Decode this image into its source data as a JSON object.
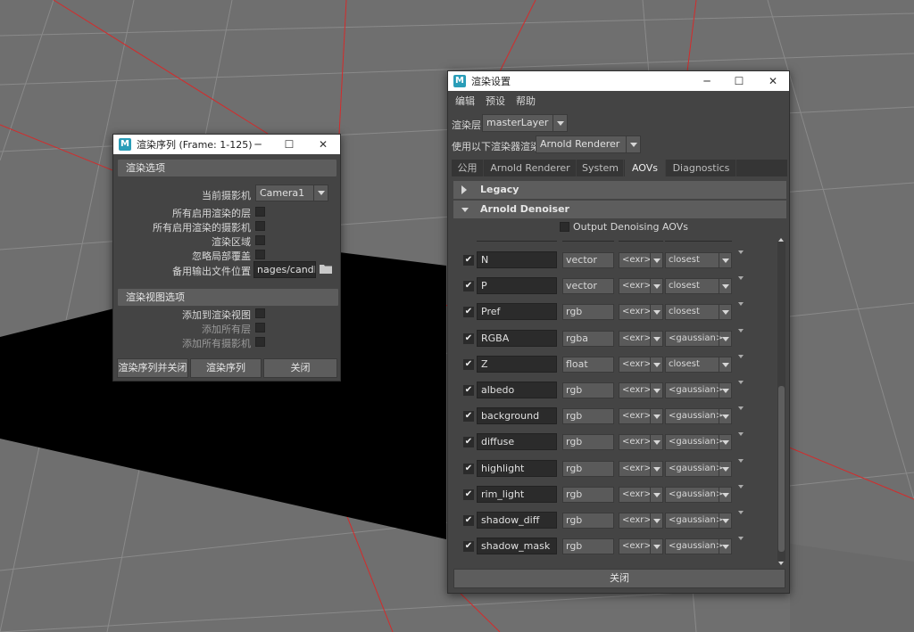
{
  "render_sequence_window": {
    "title": "渲染序列 (Frame: 1-125)",
    "section1_title": "渲染选项",
    "current_camera_label": "当前摄影机",
    "current_camera_value": "Camera1",
    "opt_layers": "所有启用渲染的层",
    "opt_cameras": "所有启用渲染的摄影机",
    "opt_region": "渲染区域",
    "opt_overrides": "忽略局部覆盖",
    "output_label": "备用输出文件位置",
    "output_value": "nages/candle",
    "section2_title": "渲染视图选项",
    "add_to_view": "添加到渲染视图",
    "add_all_layers": "添加所有层",
    "add_all_cameras": "添加所有摄影机",
    "btn_render_close": "渲染序列并关闭",
    "btn_render": "渲染序列",
    "btn_close": "关闭"
  },
  "render_settings_window": {
    "title": "渲染设置",
    "menu": [
      "编辑",
      "预设",
      "帮助"
    ],
    "layer_label": "渲染层",
    "layer_value": "masterLayer",
    "renderer_label": "使用以下渲染器渲染",
    "renderer_value": "Arnold Renderer",
    "tabs": [
      "公用",
      "Arnold Renderer",
      "System",
      "AOVs",
      "Diagnostics"
    ],
    "active_tab": "AOVs",
    "legacy_label": "Legacy",
    "denoiser_label": "Arnold Denoiser",
    "output_denoising_label": "Output Denoising AOVs",
    "close_button": "关闭",
    "aovs": [
      {
        "name": "N",
        "type": "vector",
        "driver": "<exr>",
        "filter": "closest"
      },
      {
        "name": "P",
        "type": "vector",
        "driver": "<exr>",
        "filter": "closest"
      },
      {
        "name": "Pref",
        "type": "rgb",
        "driver": "<exr>",
        "filter": "closest"
      },
      {
        "name": "RGBA",
        "type": "rgba",
        "driver": "<exr>",
        "filter": "<gaussian>"
      },
      {
        "name": "Z",
        "type": "float",
        "driver": "<exr>",
        "filter": "closest"
      },
      {
        "name": "albedo",
        "type": "rgb",
        "driver": "<exr>",
        "filter": "<gaussian>"
      },
      {
        "name": "background",
        "type": "rgb",
        "driver": "<exr>",
        "filter": "<gaussian>"
      },
      {
        "name": "diffuse",
        "type": "rgb",
        "driver": "<exr>",
        "filter": "<gaussian>"
      },
      {
        "name": "highlight",
        "type": "rgb",
        "driver": "<exr>",
        "filter": "<gaussian>"
      },
      {
        "name": "rim_light",
        "type": "rgb",
        "driver": "<exr>",
        "filter": "<gaussian>"
      },
      {
        "name": "shadow_diff",
        "type": "rgb",
        "driver": "<exr>",
        "filter": "<gaussian>"
      },
      {
        "name": "shadow_mask",
        "type": "rgb",
        "driver": "<exr>",
        "filter": "<gaussian>"
      }
    ]
  },
  "colors": {
    "panel": "#444444",
    "field": "#2b2b2b",
    "section": "#5d5d5d",
    "grid_line": "#d42b2b",
    "viewport": "#6f6f6f"
  }
}
